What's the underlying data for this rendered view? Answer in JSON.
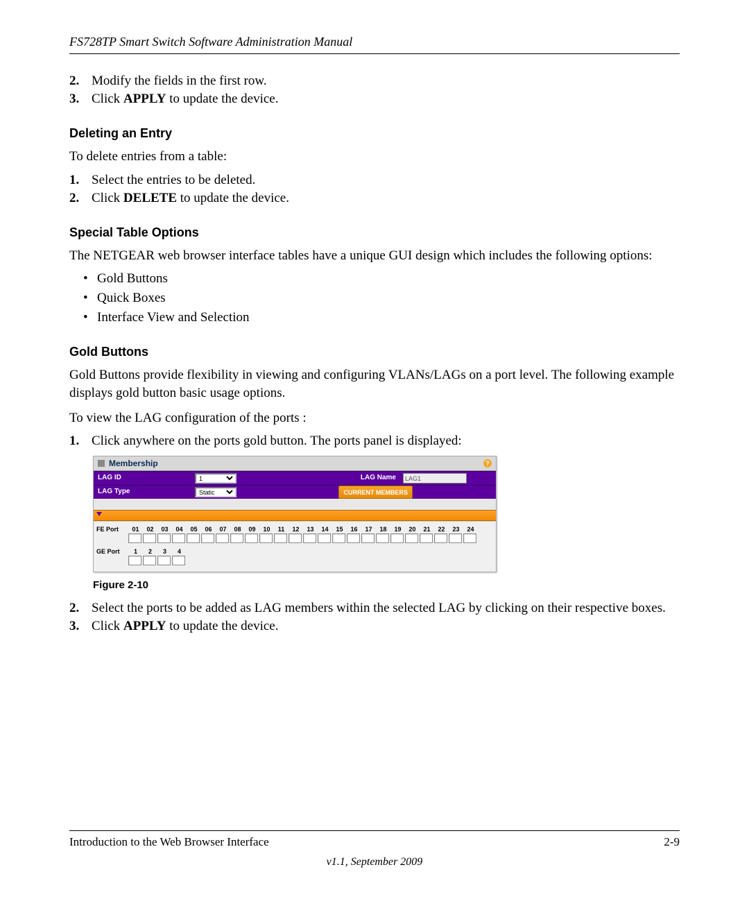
{
  "header": {
    "title": "FS728TP Smart Switch Software Administration Manual"
  },
  "topSteps": {
    "s2num": "2.",
    "s2": "Modify the fields in the first row.",
    "s3num": "3.",
    "s3a": "Click ",
    "s3bold": "APPLY",
    "s3b": " to update the device."
  },
  "deleting": {
    "heading": "Deleting an Entry",
    "intro": "To delete entries from a table:",
    "s1num": "1.",
    "s1": "Select the entries to be deleted.",
    "s2num": "2.",
    "s2a": "Click ",
    "s2bold": "DELETE",
    "s2b": " to update the device."
  },
  "special": {
    "heading": "Special Table Options",
    "intro": "The NETGEAR web browser interface tables have a unique GUI design which includes the following options:",
    "b1": "Gold Buttons",
    "b2": "Quick Boxes",
    "b3": "Interface View and Selection"
  },
  "gold": {
    "heading": "Gold Buttons",
    "p1": "Gold Buttons provide flexibility in viewing and configuring VLANs/LAGs on a port level. The following example displays gold button basic usage options.",
    "p2": "To view the LAG configuration of the ports :",
    "s1num": "1.",
    "s1": "Click anywhere on the ports gold button. The ports panel is displayed:"
  },
  "figure": {
    "title": "Membership",
    "help": "?",
    "row1": {
      "label1": "LAG ID",
      "select": "1",
      "label2": "LAG Name",
      "inputValue": "LAG1"
    },
    "row2": {
      "label1": "LAG Type",
      "select": "Static",
      "button": "CURRENT MEMBERS"
    },
    "feLabel": "FE Port",
    "fePorts": [
      "01",
      "02",
      "03",
      "04",
      "05",
      "06",
      "07",
      "08",
      "09",
      "10",
      "11",
      "12",
      "13",
      "14",
      "15",
      "16",
      "17",
      "18",
      "19",
      "20",
      "21",
      "22",
      "23",
      "24"
    ],
    "geLabel": "GE Port",
    "gePorts": [
      "1",
      "2",
      "3",
      "4"
    ],
    "caption": "Figure 2-10"
  },
  "afterFig": {
    "s2num": "2.",
    "s2": "Select the  ports to be added as LAG members within the selected LAG by clicking on their respective boxes.",
    "s3num": "3.",
    "s3a": "Click ",
    "s3bold": "APPLY",
    "s3b": " to update the device."
  },
  "footer": {
    "left": "Introduction to the Web Browser Interface",
    "right": "2-9",
    "version": "v1.1, September 2009"
  }
}
